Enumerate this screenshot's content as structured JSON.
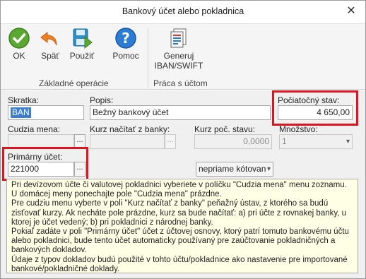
{
  "window": {
    "title": "Bankový účet alebo pokladnica",
    "close_glyph": "✕"
  },
  "ribbon": {
    "groups": [
      {
        "label": "Základné operácie"
      },
      {
        "label": "Práca s účtom"
      }
    ],
    "buttons": {
      "ok": {
        "label": "OK",
        "icon": "check-icon"
      },
      "back": {
        "label": "Späť",
        "icon": "undo-icon"
      },
      "use": {
        "label": "Použiť",
        "icon": "save-icon"
      },
      "help": {
        "label": "Pomoc",
        "icon": "help-icon"
      },
      "iban": {
        "label_line1": "Generuj",
        "label_line2": "IBAN/SWIFT",
        "icon": "generate-document-icon"
      }
    }
  },
  "form": {
    "shortcut": {
      "label": "Skratka:",
      "value": "BAN"
    },
    "description": {
      "label": "Popis:",
      "value": "Bežný bankový účet"
    },
    "initial_balance": {
      "label": "Počiatočný stav:",
      "value": "4 650,00"
    },
    "foreign_currency": {
      "label": "Cudzia mena:",
      "value": ""
    },
    "rate_from_bank": {
      "label": "Kurz načítať z banky:",
      "value": ""
    },
    "initial_rate": {
      "label": "Kurz poč. stavu:",
      "value": "0,0000"
    },
    "quantity": {
      "label": "Množstvo:",
      "value": "1"
    },
    "primary_account": {
      "label": "Primárny účet:",
      "value": "221000"
    },
    "quotation": {
      "value": "nepriame kótovan"
    },
    "dots_label": "...",
    "combo_arrow": "▾"
  },
  "info": {
    "paragraphs": [
      "Pri devízovom účte či valutovej pokladnici vyberiete v políčku \"Cudzia mena\" menu zoznamu. U domácej meny ponechajte pole \"Cudzia mena\" prázdne.",
      "Pre cudziu menu vyberte v poli \"Kurz načítať z banky\" peňažný ústav, z ktorého sa budú zisťovať kurzy. Ak necháte pole prázdne, kurz sa bude načítať: a) pri účte z rovnakej banky, u ktorej je účet vedený; b) pri pokladnici z národnej banky.",
      "Pokiaľ zadáte v poli \"Primárny účet\" účet z účtovej osnovy, ktorý patrí tomuto bankovému účtu alebo pokladnici, bude tento účet automaticky používaný pre zaúčtovanie pokladničných a bankových dokladov.",
      "Údaje z typov dokladov budú použité v tohto účtu/pokladnice ako nastavenie pre importované bankové/pokladničné doklady."
    ]
  },
  "colors": {
    "highlight_border": "#e0141e",
    "selection": "#3c7fd0",
    "info_background": "#ffffe6"
  }
}
